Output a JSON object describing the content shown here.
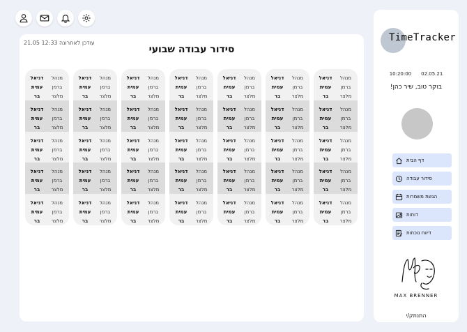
{
  "topbar": {
    "icons": [
      "user-icon",
      "mail-icon",
      "bell-icon",
      "gear-icon"
    ]
  },
  "main": {
    "last_updated": "עודכן לאחרונה  12:33 21.05",
    "title": "סידור עבודה שבועי",
    "shift": {
      "role_lines": [
        "מנהל",
        "ברמן",
        "מלצר"
      ],
      "name_lines": [
        "דניאל",
        "עמית",
        "בר"
      ]
    },
    "day_count": 7,
    "shifts_per_day": 5
  },
  "sidebar": {
    "logo_text": "TimeTracker",
    "time": "10:20:00",
    "date": "02.05.21",
    "greeting": "בוקר טוב, שיר כהן!",
    "nav": [
      {
        "label": "דף הבית",
        "icon": "home-icon"
      },
      {
        "label": "סידור עבודה",
        "icon": "clock-icon"
      },
      {
        "label": "הגשת משמרות",
        "icon": "calendar-icon"
      },
      {
        "label": "דוחות",
        "icon": "image-icon"
      },
      {
        "label": "דיווח נוכחות",
        "icon": "edit-icon"
      }
    ],
    "signature_name": "MAX BRENNER",
    "logout": "התנתק/י"
  },
  "colors": {
    "background": "#eef1f8",
    "nav_item": "#dbe5fb",
    "day_card": "#f1f1f1",
    "alt_shift": "#dcdcdc"
  }
}
